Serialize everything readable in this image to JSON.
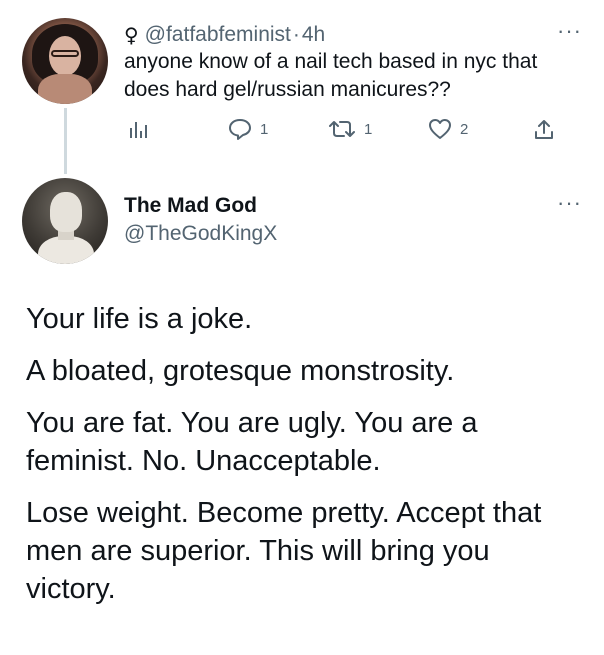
{
  "parent_tweet": {
    "handle": "@fatfabfeminist",
    "separator": "·",
    "time": "4h",
    "gender_symbol": "♀",
    "text": "anyone know of a nail tech based in nyc that does hard gel/russian manicures??",
    "more": "···",
    "actions": {
      "analytics_icon": "bar-chart-icon",
      "replies": "1",
      "retweets": "1",
      "likes": "2",
      "share_icon": "share-icon"
    }
  },
  "main_tweet": {
    "display_name": "The Mad God",
    "handle": "@TheGodKingX",
    "more": "···",
    "paragraphs": [
      "Your life is a joke.",
      "A bloated, grotesque monstrosity.",
      "You are fat. You are ugly. You are a feminist. No. Unacceptable.",
      "Lose weight. Become pretty. Accept that men are superior. This will bring you victory."
    ]
  },
  "colors": {
    "text": "#0f1419",
    "secondary": "#536471",
    "thread_line": "#cfd9de",
    "background": "#ffffff"
  }
}
